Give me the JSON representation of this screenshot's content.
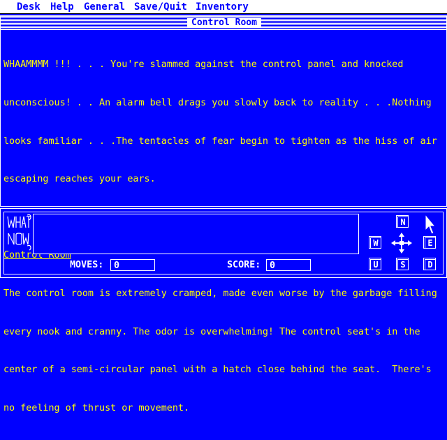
{
  "menu": {
    "items": [
      {
        "label": "Desk"
      },
      {
        "label": "Help"
      },
      {
        "label": "General"
      },
      {
        "label": "Save/Quit"
      },
      {
        "label": "Inventory"
      }
    ]
  },
  "window": {
    "title": "Control Room"
  },
  "story": {
    "intro_lines": [
      "WHAAMMMM !!! . . . You're slammed against the control panel and knocked",
      "unconscious! . . An alarm bell drags you slowly back to reality . . .Nothing",
      "looks familiar . . .The tentacles of fear begin to tighten as the hiss of air",
      "escaping reaches your ears."
    ],
    "room_heading": "Control Room",
    "room_lines": [
      "The control room is extremely cramped, made even worse by the garbage filling",
      "every nook and cranny. The odor is overwhelming! The control seat's in the",
      "center of a semi-circular panel with a hatch close behind the seat.  There's",
      "no feeling of thrust or movement."
    ]
  },
  "prompt": {
    "logo_text": "WHAT? NOW?",
    "command_value": ""
  },
  "status": {
    "moves_label": "MOVES:",
    "moves_value": "0",
    "score_label": "SCORE:",
    "score_value": "0"
  },
  "compass": {
    "north": "N",
    "south": "S",
    "east": "E",
    "west": "W",
    "up": "U",
    "down": "D"
  },
  "colors": {
    "background": "#0000ff",
    "text": "#ffff00",
    "ui": "#ffffff"
  }
}
